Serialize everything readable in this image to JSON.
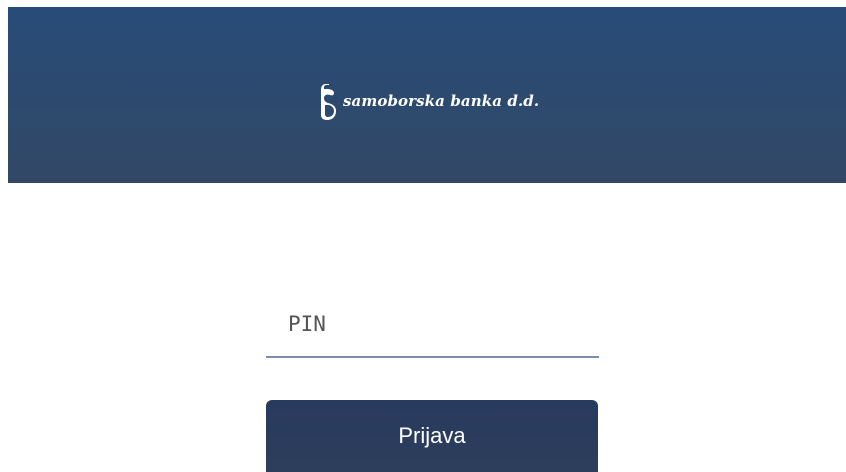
{
  "header": {
    "logo_icon": "samoborska-banka-logo-mark",
    "logo_text": "samoborska banka d.d.",
    "background_color": "#2b4a72"
  },
  "login": {
    "pin_placeholder": "PIN",
    "pin_value": "",
    "submit_label": "Prijava",
    "button_color": "#2a3c5d"
  }
}
